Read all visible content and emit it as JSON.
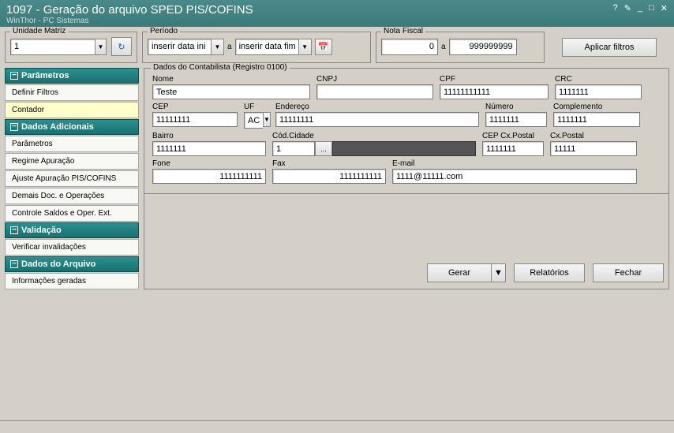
{
  "title": "1097 - Geração do arquivo SPED PIS/COFINS",
  "subtitle": "WinThor - PC Sistemas",
  "toolbar": {
    "unidade_matriz_label": "Unidade Matriz",
    "unidade_matriz_value": "1",
    "periodo_label": "Período",
    "data_ini_placeholder": "inserir data ini",
    "a_label": "a",
    "data_fim_placeholder": "inserir data fim",
    "nota_fiscal_label": "Nota Fiscal",
    "nf_from": "0",
    "nf_to": "999999999",
    "aplicar_filtros": "Aplicar filtros"
  },
  "sidebar": {
    "parametros_header": "Parâmetros",
    "definir_filtros": "Definir Filtros",
    "contador": "Contador",
    "dados_adicionais_header": "Dados Adicionais",
    "parametros": "Parâmetros",
    "regime_apuracao": "Regime Apuração",
    "ajuste_apuracao": "Ajuste Apuração PIS/COFINS",
    "demais_doc": "Demais Doc. e Operações",
    "controle_saldos": "Controle Saldos e Oper. Ext.",
    "validacao_header": "Validação",
    "verificar_invalidacoes": "Verificar invalidações",
    "dados_arquivo_header": "Dados do Arquivo",
    "informacoes_geradas": "Informações geradas"
  },
  "form": {
    "legend": "Dados do Contabilista (Registro 0100)",
    "nome_label": "Nome",
    "nome": "Teste",
    "cnpj_label": "CNPJ",
    "cnpj": "",
    "cpf_label": "CPF",
    "cpf": "11111111111",
    "crc_label": "CRC",
    "crc": "1111111",
    "cep_label": "CEP",
    "cep": "11111111",
    "uf_label": "UF",
    "uf": "AC",
    "endereco_label": "Endereço",
    "endereco": "11111111",
    "numero_label": "Número",
    "numero": "1111111",
    "complemento_label": "Complemento",
    "complemento": "1111111",
    "bairro_label": "Bairro",
    "bairro": "1111111",
    "cod_cidade_label": "Cód.Cidade",
    "cod_cidade": "1",
    "cep_cx_label": "CEP Cx.Postal",
    "cep_cx": "1111111",
    "cx_postal_label": "Cx.Postal",
    "cx_postal": "11111",
    "fone_label": "Fone",
    "fone": "1111111111",
    "fax_label": "Fax",
    "fax": "1111111111",
    "email_label": "E-mail",
    "email": "1111@11111.com"
  },
  "buttons": {
    "gerar": "Gerar",
    "relatorios": "Relatórios",
    "fechar": "Fechar"
  }
}
